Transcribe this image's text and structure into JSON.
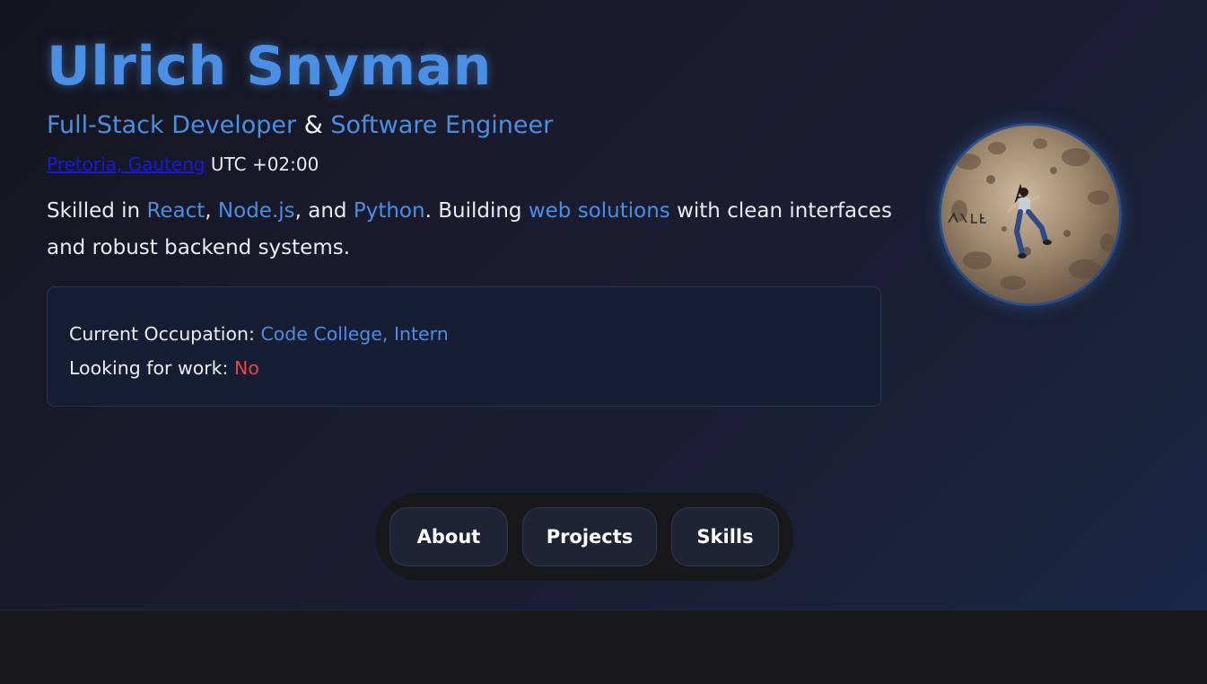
{
  "profile": {
    "name": "Ulrich Snyman",
    "role_1": "Full-Stack Developer",
    "role_sep": " & ",
    "role_2": "Software Engineer",
    "location_link": "Pretoria, Gauteng",
    "timezone": " UTC +02:00",
    "avatar_alt": "Profile photo"
  },
  "bio": {
    "t1": "Skilled in ",
    "k1": "React",
    "t2": ", ",
    "k2": "Node.js",
    "t3": ", and ",
    "k3": "Python",
    "t4": ". Building ",
    "k4": "web solutions",
    "t5": " with clean interfaces and robust backend systems."
  },
  "status_card": {
    "occupation_label": "Current Occupation: ",
    "occupation_value": "Code College, Intern",
    "work_label": "Looking for work: ",
    "work_value": "No"
  },
  "nav": {
    "about": "About",
    "projects": "Projects",
    "skills": "Skills"
  },
  "colors": {
    "accent": "#4a8fe4",
    "negative": "#e24848",
    "link": "#1818e6"
  }
}
